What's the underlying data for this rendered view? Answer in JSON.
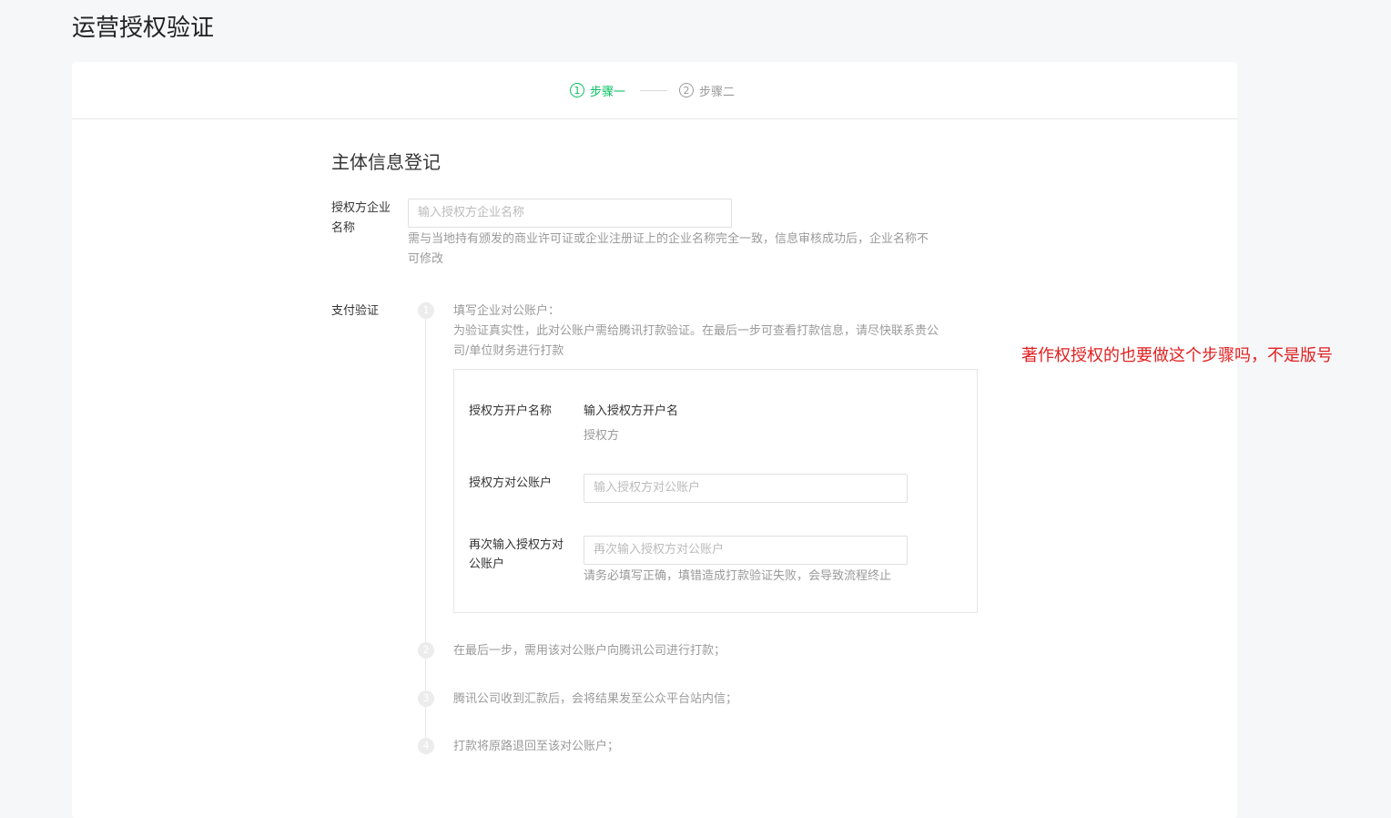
{
  "page": {
    "title": "运营授权验证"
  },
  "steps": [
    {
      "num": "1",
      "label": "步骤一",
      "state": "active"
    },
    {
      "num": "2",
      "label": "步骤二",
      "state": "inactive"
    }
  ],
  "form": {
    "section_title": "主体信息登记",
    "company_name": {
      "label_line1": "授权方企业",
      "label_line2": "名称",
      "placeholder": "输入授权方企业名称",
      "hint_line1": "需与当地持有颁发的商业许可证或企业注册证上的企业名称完全一致，信息审核成功后，企业名称不",
      "hint_line2": "可修改"
    },
    "payment_verify": {
      "label": "支付验证",
      "timeline": [
        {
          "num": "1",
          "title": "填写企业对公账户：",
          "desc_line1": "为验证真实性，此对公账户需给腾讯打款验证。在最后一步可查看打款信息，请尽快联系贵公",
          "desc_line2": "司/单位财务进行打款"
        },
        {
          "num": "2",
          "text": "在最后一步，需用该对公账户向腾讯公司进行打款；"
        },
        {
          "num": "3",
          "text": "腾讯公司收到汇款后，会将结果发至公众平台站内信；"
        },
        {
          "num": "4",
          "text": "打款将原路退回至该对公账户；"
        }
      ],
      "account_name": {
        "label": "授权方开户名称",
        "value": "输入授权方开户名",
        "sub": "授权方"
      },
      "account": {
        "label": "授权方对公账户",
        "placeholder": "输入授权方对公账户"
      },
      "account_confirm": {
        "label_line1": "再次输入授权方对",
        "label_line2": "公账户",
        "placeholder": "再次输入授权方对公账户",
        "hint": "请务必填写正确，填错造成打款验证失败，会导致流程终止"
      }
    }
  },
  "annotation": {
    "text": "著作权授权的也要做这个步骤吗，不是版号"
  },
  "colors": {
    "accent": "#07c160",
    "annotation": "#e02020"
  }
}
